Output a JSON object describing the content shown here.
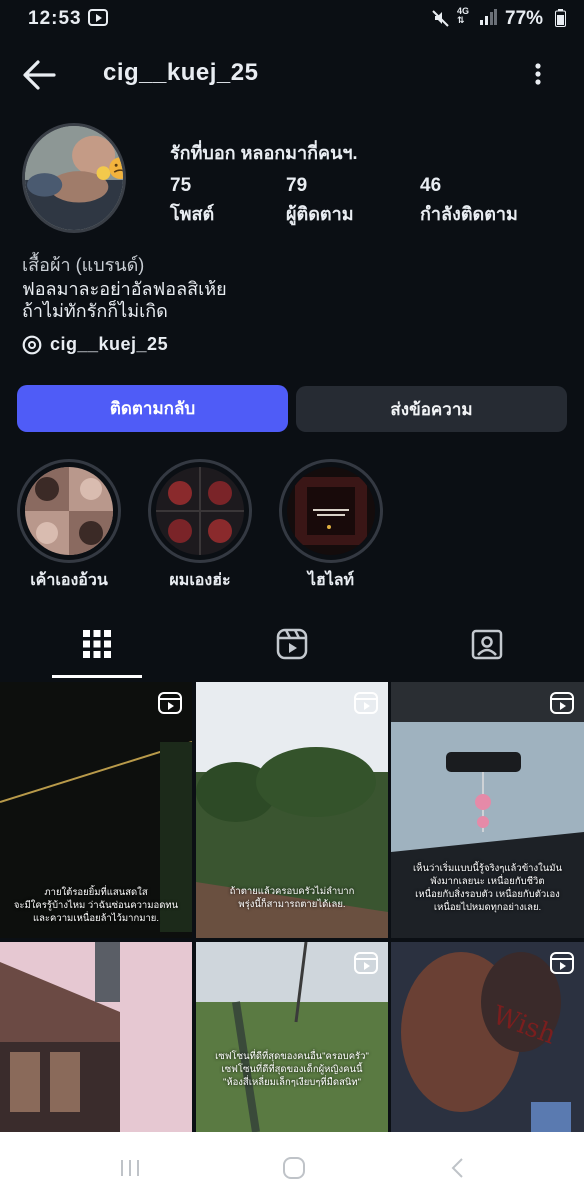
{
  "status_bar": {
    "time": "12:53",
    "network": "4G",
    "battery": "77%"
  },
  "header": {
    "username": "cig__kuej_25"
  },
  "profile": {
    "bio_line": "รักที่บอก หลอกมากี่คนฯ.",
    "stats": [
      {
        "value": "75",
        "label": "โพสต์"
      },
      {
        "value": "79",
        "label": "ผู้ติดตาม"
      },
      {
        "value": "46",
        "label": "กำลังติดตาม"
      }
    ],
    "name": "เสื้อผ้า (แบรนด์)",
    "bio": [
      "ฟอลมาละอย่าอัลฟอลสิเห้ย",
      "ถ้าไม่ทักรักก็ไม่เกิด"
    ],
    "threads_handle": "cig__kuej_25"
  },
  "actions": {
    "follow_back": "ติดตามกลับ",
    "message": "ส่งข้อความ"
  },
  "highlights": [
    {
      "label": "เค้าเองอ้วน"
    },
    {
      "label": "ผมเองฮ่ะ"
    },
    {
      "label": "ไฮไลท์"
    }
  ],
  "tabs": [
    "grid-icon",
    "reels-icon",
    "tagged-icon"
  ],
  "posts": [
    {
      "caption": "ภายใต้รอยยิ้มที่แสนสดใส\nจะมีใครรู้บ้างไหม ว่าฉันซ่อนความอดทน\nและความเหนื่อยล้าไว้มากมาย."
    },
    {
      "caption": "ถ้าตายแล้วครอบครัวไม่ลำบาก\nพรุ่งนี้ก็สามารถตายได้เลย."
    },
    {
      "caption": "เห็นว่าเริ่มแบบนี้รู้จริงๆแล้วข้างในมัน\nพังมากเลยนะ เหนื่อยกับชีวิต\nเหนื่อยกับสิ่งรอบตัว เหนื่อยกับตัวเอง\nเหนื่อยไปหมดทุกอย่างเลย."
    },
    {
      "caption": ""
    },
    {
      "caption": "เซฟโซนที่ดีที่สุดของคนอื่น\"ครอบครัว\"\nเซฟโซนที่ดีที่สุดของเด็กผู้หญิงคนนี้\n\"ห้องสี่เหลี่ยมเล็กๆเงียบๆที่มืดสนิท\""
    },
    {
      "caption": ""
    }
  ],
  "colors": {
    "background": "#0b0f14",
    "primary_button": "#4f5cf7",
    "secondary_button": "#262b33"
  }
}
